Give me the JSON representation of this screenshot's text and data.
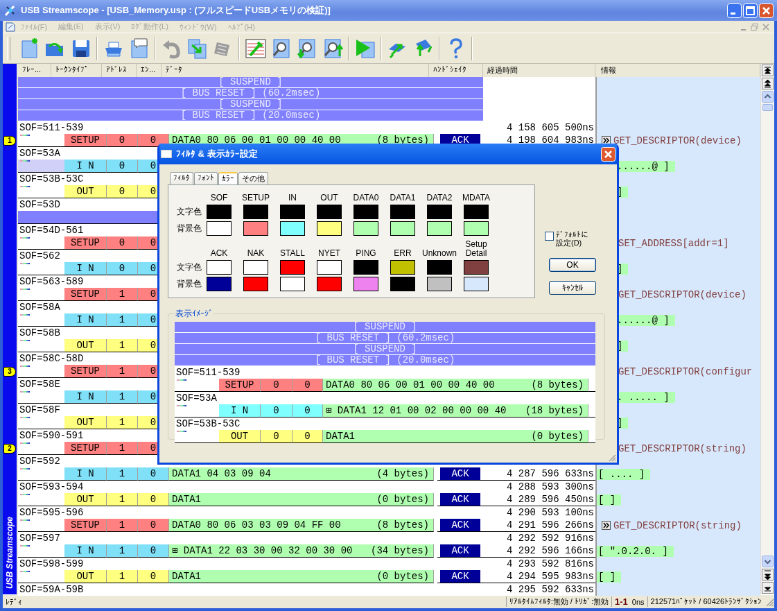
{
  "window": {
    "title": "USB Streamscope - [USB_Memory.usp : (フルスピードUSBメモリの検証)]"
  },
  "menu": [
    {
      "label": "ﾌｧｲﾙ(F)",
      "disabled": true
    },
    {
      "label": "編集(E)",
      "disabled": true
    },
    {
      "label": "表示(V)",
      "disabled": true
    },
    {
      "label": "ﾛｸﾞ動作(L)",
      "disabled": true
    },
    {
      "label": "ｳｨﾝﾄﾞｳ(W)",
      "disabled": true
    },
    {
      "label": "ﾍﾙﾌﾟ(H)",
      "disabled": true
    }
  ],
  "toolbar": [
    [
      {
        "kind": "new",
        "disabled": false
      },
      {
        "kind": "open",
        "disabled": false
      },
      {
        "kind": "save",
        "disabled": false
      }
    ],
    [
      {
        "kind": "print",
        "disabled": false
      },
      {
        "kind": "note",
        "disabled": false
      }
    ],
    [
      {
        "kind": "undo",
        "disabled": true
      },
      {
        "kind": "copy",
        "disabled": false
      },
      {
        "kind": "chip",
        "disabled": true
      }
    ],
    [
      {
        "kind": "settings",
        "disabled": false
      },
      {
        "kind": "find",
        "disabled": false
      },
      {
        "kind": "find_down",
        "disabled": false
      },
      {
        "kind": "find_up",
        "disabled": false
      }
    ],
    [
      {
        "kind": "play",
        "disabled": false
      }
    ],
    [
      {
        "kind": "transfer_a",
        "disabled": false
      },
      {
        "kind": "transfer_b",
        "disabled": false
      }
    ],
    [
      {
        "kind": "help",
        "disabled": false
      }
    ]
  ],
  "sidebar_logo": "USB Streamscope",
  "table": {
    "columns": [
      "ﾌﾚｰ...",
      "ﾄｰｸﾝﾀｲﾌﾟ",
      "ｱﾄﾞﾚｽ",
      "ｴﾝ...",
      "ﾃﾞｰﾀ",
      "ﾊﾝﾄﾞｼｪｲｸ",
      "経過時間",
      "情報"
    ],
    "bus_events": [
      "[ SUSPEND ]",
      "[ BUS RESET ] (60.2msec)",
      "[ SUSPEND ]",
      "[ BUS RESET ] (20.0msec)"
    ],
    "transactions": [
      {
        "sof": "SOF=511-539",
        "sof_time": "4 158 605 500ns",
        "selected": false,
        "bookmark": "1",
        "kind": "setup",
        "token": "SETUP",
        "addr": "0",
        "endp": "0",
        "data": "DATA0 80 06 00 01 00 00 40 00",
        "bytes": "(8 bytes)",
        "handshake": "ACK",
        "time": "4 198 604 983ns",
        "info": {
          "kind": "request",
          "text": "GET_DESCRIPTOR(device)",
          "detail_icon": true
        }
      },
      {
        "sof": "SOF=53A",
        "selected": true,
        "kind": "in",
        "token": "I N",
        "addr": "0",
        "endp": "0",
        "info": {
          "kind": "payload",
          "text": "......@ ]",
          "detail_icon": false
        }
      },
      {
        "sof": "SOF=53B-53C",
        "selected": false,
        "kind": "out",
        "token": "OUT",
        "addr": "0",
        "endp": "0",
        "info": {
          "kind": "payload",
          "text": "]",
          "detail_icon": false
        }
      },
      {
        "sof": "SOF=53D",
        "selected": false,
        "kind": "event"
      },
      {
        "sof": "SOF=54D-561",
        "selected": false,
        "kind": "setup",
        "token": "SETUP",
        "addr": "0",
        "endp": "0",
        "info": {
          "kind": "request",
          "text": "SET_ADDRESS[addr=1]",
          "detail_icon": false
        }
      },
      {
        "sof": "SOF=562",
        "selected": false,
        "kind": "in",
        "token": "I N",
        "addr": "0",
        "endp": "0",
        "info": {
          "kind": "payload",
          "text": "]",
          "detail_icon": false
        }
      },
      {
        "sof": "SOF=563-589",
        "selected": false,
        "kind": "setup",
        "token": "SETUP",
        "addr": "1",
        "endp": "0",
        "info": {
          "kind": "request",
          "text": "GET_DESCRIPTOR(device)",
          "detail_icon": false
        }
      },
      {
        "sof": "SOF=58A",
        "selected": false,
        "kind": "in",
        "token": "I N",
        "addr": "1",
        "endp": "0",
        "info": {
          "kind": "payload",
          "text": "......@ ]",
          "detail_icon": false
        }
      },
      {
        "sof": "SOF=58B",
        "selected": false,
        "kind": "out",
        "token": "OUT",
        "addr": "1",
        "endp": "0",
        "info": {
          "kind": "payload",
          "text": "]",
          "detail_icon": false
        }
      },
      {
        "sof": "SOF=58C-58D",
        "selected": false,
        "bookmark": "3",
        "kind": "setup",
        "token": "SETUP",
        "addr": "1",
        "endp": "0",
        "info": {
          "kind": "request",
          "text": "GET_DESCRIPTOR(configur",
          "detail_icon": false
        }
      },
      {
        "sof": "SOF=58E",
        "selected": false,
        "kind": "in",
        "token": "I N",
        "addr": "1",
        "endp": "0",
        "info": {
          "kind": "payload",
          "text": ". ..... ]",
          "detail_icon": false
        }
      },
      {
        "sof": "SOF=58F",
        "selected": false,
        "kind": "out",
        "token": "OUT",
        "addr": "1",
        "endp": "0",
        "info": {
          "kind": "payload",
          "text": "]",
          "detail_icon": false
        }
      },
      {
        "sof": "SOF=590-591",
        "selected": false,
        "bookmark": "2",
        "kind": "setup",
        "token": "SETUP",
        "addr": "1",
        "endp": "0",
        "info": {
          "kind": "request",
          "text": "GET_DESCRIPTOR(string)",
          "detail_icon": false
        }
      },
      {
        "sof": "SOF=592",
        "selected": false,
        "kind": "in",
        "token": "I N",
        "addr": "1",
        "endp": "0",
        "data": "DATA1 04 03 09 04",
        "bytes": "(4 bytes)",
        "handshake": "ACK",
        "time": "4 287 596 633ns",
        "info": {
          "kind": "payload",
          "text": "[ .... ]",
          "detail_icon": false
        }
      },
      {
        "sof": "SOF=593-594",
        "sof_time": "4 288 593 300ns",
        "selected": false,
        "kind": "out",
        "token": "OUT",
        "addr": "1",
        "endp": "0",
        "data": "DATA1",
        "bytes": "(0 bytes)",
        "handshake": "ACK",
        "time": "4 289 596 450ns",
        "info": {
          "kind": "payload",
          "text": "[  ]",
          "detail_icon": false
        }
      },
      {
        "sof": "SOF=595-596",
        "sof_time": "4 290 593 100ns",
        "selected": false,
        "kind": "setup",
        "token": "SETUP",
        "addr": "1",
        "endp": "0",
        "data": "DATA0 80 06 03 03 09 04 FF 00",
        "bytes": "(8 bytes)",
        "handshake": "ACK",
        "time": "4 291 596 266ns",
        "info": {
          "kind": "request",
          "text": "GET_DESCRIPTOR(string)",
          "detail_icon": true
        }
      },
      {
        "sof": "SOF=597",
        "sof_time": "4 292 592 916ns",
        "selected": false,
        "kind": "in",
        "token": "I N",
        "addr": "1",
        "endp": "0",
        "data": "⊞ DATA1 22 03 30 00 32 00 30 00",
        "bytes": "(34 bytes)",
        "handshake": "ACK",
        "time": "4 292 596 166ns",
        "info": {
          "kind": "payload",
          "text": "[ \".0.2.0. ]",
          "detail_icon": false
        }
      },
      {
        "sof": "SOF=598-599",
        "sof_time": "4 293 592 816ns",
        "selected": false,
        "kind": "out",
        "token": "OUT",
        "addr": "1",
        "endp": "0",
        "data": "DATA1",
        "bytes": "(0 bytes)",
        "handshake": "ACK",
        "time": "4 294 595 983ns",
        "info": {
          "kind": "payload",
          "text": "[  ]",
          "detail_icon": false
        }
      },
      {
        "sof": "SOF=59A-59B",
        "sof_time": "4 295 592 633ns",
        "selected": false,
        "kind": "sof_only"
      }
    ]
  },
  "dialog": {
    "title": "ﾌｨﾙﾀ & 表示ｶﾗｰ設定",
    "tabs": [
      {
        "label": "ﾌｨﾙﾀ",
        "selected": false
      },
      {
        "label": "ﾌｫﾝﾄ",
        "selected": false
      },
      {
        "label": "ｶﾗｰ",
        "selected": true
      },
      {
        "label": "その他",
        "selected": false
      }
    ],
    "color_groups": [
      {
        "row_labels": [
          "文字色",
          "背景色"
        ],
        "columns": [
          {
            "label": "SOF",
            "swatches": [
              {
                "color": "#000000"
              },
              {
                "color": "#ffffff"
              }
            ]
          },
          {
            "label": "SETUP",
            "swatches": [
              {
                "color": "#000000"
              },
              {
                "color": "#ff8080"
              }
            ]
          },
          {
            "label": "IN",
            "swatches": [
              {
                "color": "#000000"
              },
              {
                "color": "#80ffff"
              }
            ]
          },
          {
            "label": "OUT",
            "swatches": [
              {
                "color": "#000000"
              },
              {
                "color": "#ffff80"
              }
            ]
          },
          {
            "label": "DATA0",
            "swatches": [
              {
                "color": "#000000"
              },
              {
                "color": "#b0ffb0"
              }
            ]
          },
          {
            "label": "DATA1",
            "swatches": [
              {
                "color": "#000000"
              },
              {
                "color": "#b0ffb0"
              }
            ]
          },
          {
            "label": "DATA2",
            "swatches": [
              {
                "color": "#000000"
              },
              {
                "color": "#b0ffb0"
              }
            ]
          },
          {
            "label": "MDATA",
            "swatches": [
              {
                "color": "#000000"
              },
              {
                "color": "#b0ffb0"
              }
            ]
          }
        ]
      },
      {
        "row_labels": [
          "文字色",
          "背景色"
        ],
        "columns": [
          {
            "label": "ACK",
            "swatches": [
              {
                "color": "#ffffff"
              },
              {
                "color": "#000099"
              }
            ]
          },
          {
            "label": "NAK",
            "swatches": [
              {
                "color": "#ffffff"
              },
              {
                "color": "#ff0000"
              }
            ]
          },
          {
            "label": "STALL",
            "swatches": [
              {
                "color": "#ff0000"
              },
              {
                "color": "#ffffff"
              }
            ]
          },
          {
            "label": "NYET",
            "swatches": [
              {
                "color": "#ffffff"
              },
              {
                "color": "#ff0000"
              }
            ]
          },
          {
            "label": "PING",
            "swatches": [
              {
                "color": "#000000"
              },
              {
                "color": "#ee82ee"
              }
            ]
          },
          {
            "label": "ERR",
            "swatches": [
              {
                "color": "#c0c000"
              },
              {
                "color": "#000000"
              }
            ]
          },
          {
            "label": "Unknown",
            "swatches": [
              {
                "color": "#000000"
              },
              {
                "color": "#c0c0c0"
              }
            ]
          },
          {
            "label": "Setup Detail",
            "swatches": [
              {
                "color": "#804040"
              },
              {
                "color": "#d8e8fc"
              }
            ]
          }
        ]
      }
    ],
    "default_checkbox": {
      "label": "ﾃﾞﾌｫﾙﾄに設定(D)",
      "checked": false
    },
    "buttons": [
      "OK",
      "ｷｬﾝｾﾙ"
    ],
    "preview": {
      "title": "表示ｲﾒｰｼﾞ",
      "bus_events": [
        "[ SUSPEND ]",
        "[ BUS RESET ] (60.2msec)",
        "[ SUSPEND ]",
        "[ BUS RESET ] (20.0msec)"
      ],
      "transactions": [
        {
          "sof": "SOF=511-539",
          "kind": "setup",
          "token": "SETUP",
          "addr": "0",
          "endp": "0",
          "data": "DATA0 80 06 00 01 00 00 40 00",
          "bytes": "(8 bytes)"
        },
        {
          "sof": "SOF=53A",
          "kind": "in",
          "token": "I N",
          "addr": "0",
          "endp": "0",
          "data": "⊞ DATA1 12 01 00 02 00 00 00 40",
          "bytes": "(18 bytes)"
        },
        {
          "sof": "SOF=53B-53C",
          "kind": "out",
          "token": "OUT",
          "addr": "0",
          "endp": "0",
          "data": "DATA1",
          "bytes": "(0 bytes)"
        }
      ]
    }
  },
  "status_bar": {
    "message": "ﾚﾃﾞｨ",
    "filter": "ﾘｱﾙﾀｲﾑﾌｨﾙﾀ:無効 / ﾄﾘｶﾞ:無効",
    "cursor": "1-1",
    "offset": "0ns",
    "counts": "212571ﾊﾟｹｯﾄ / 60426ﾄﾗﾝｻﾞｸｼｮﾝ"
  }
}
